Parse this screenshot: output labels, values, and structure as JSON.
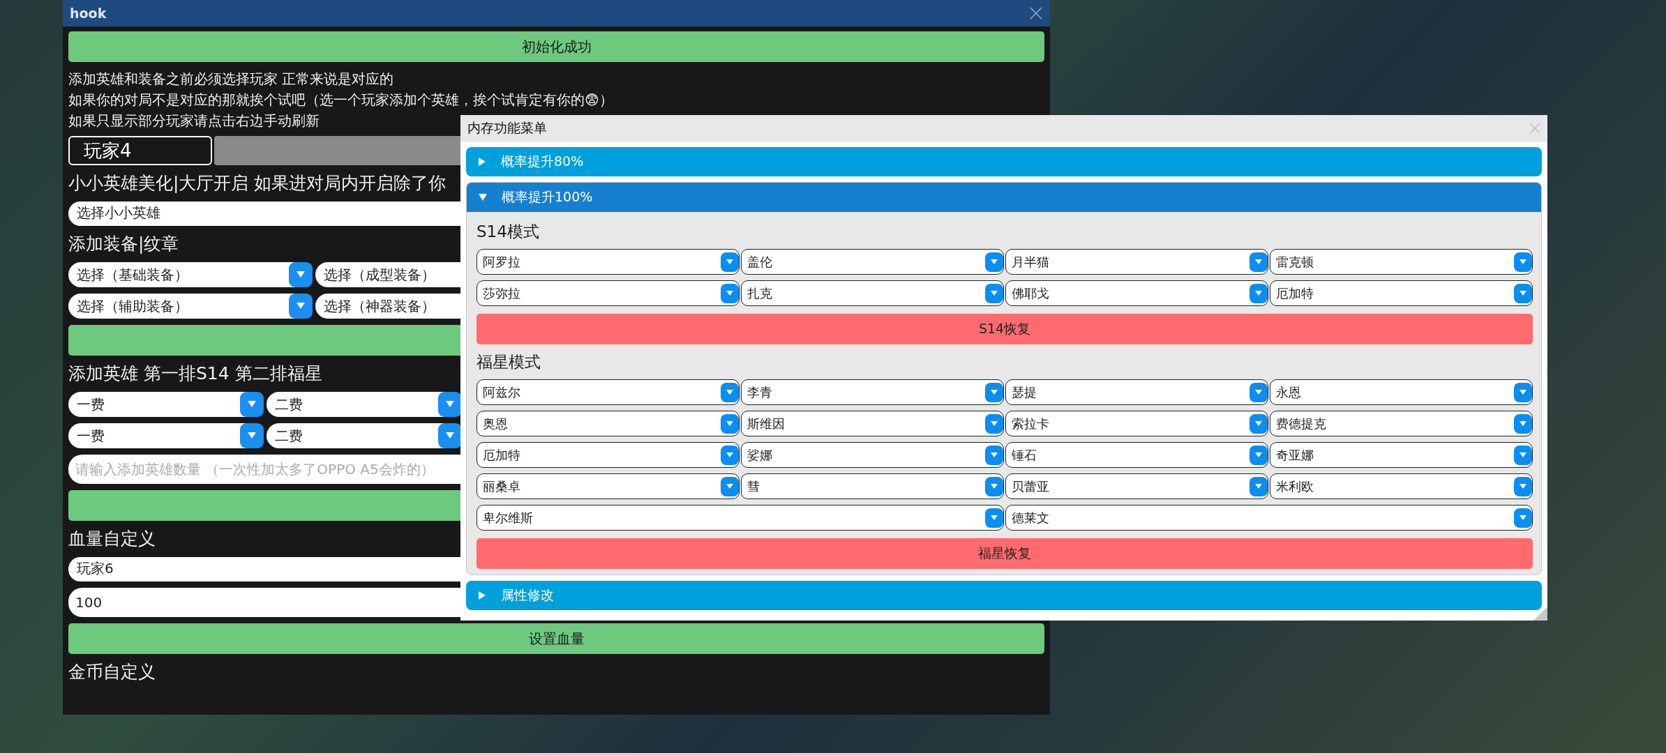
{
  "hook_window": {
    "title": "hook",
    "items": [
      {
        "kind": "button",
        "label": "初始化成功"
      },
      {
        "kind": "notes",
        "lines": [
          "添加英雄和装备之前必须选择玩家 正常来说是对应的",
          "如果你的对局不是对应的那就挨个试吧（选一个玩家添加个英雄，挨个试肯定有你的😨）",
          "如果只显示部分玩家请点击右边手动刷新"
        ]
      },
      {
        "kind": "tabs",
        "tabs": [
          {
            "label": "玩家4",
            "selected": true
          }
        ]
      },
      {
        "kind": "heading",
        "text": "小小英雄美化|大厅开启 如果进对局内开启除了你"
      },
      {
        "kind": "field",
        "value": "选择小小英雄"
      },
      {
        "kind": "heading",
        "text": "添加装备|纹章"
      },
      {
        "kind": "equip_selects",
        "options": [
          "选择（基础装备）",
          "选择（成型装备）"
        ]
      },
      {
        "kind": "equip_selects",
        "options": [
          "选择（辅助装备）",
          "选择（神器装备）"
        ]
      },
      {
        "kind": "button"
      },
      {
        "kind": "heading",
        "text": "添加英雄 第一排S14 第二排福星"
      },
      {
        "kind": "hero_selects",
        "options": [
          "一费",
          "二费"
        ]
      },
      {
        "kind": "hero_selects",
        "options": [
          "一费",
          "二费"
        ]
      },
      {
        "kind": "input",
        "placeholder": "请输入添加英雄数量 （一次性加太多了OPPO A5会炸的）"
      },
      {
        "kind": "button"
      },
      {
        "kind": "heading",
        "text": "血量自定义"
      },
      {
        "kind": "field",
        "value": "玩家6"
      },
      {
        "kind": "input",
        "value": "100"
      },
      {
        "kind": "button",
        "label": "设置血量"
      },
      {
        "kind": "heading",
        "text": "金币自定义"
      }
    ]
  },
  "memory_menu": {
    "title": "内存功能菜单",
    "sections": [
      {
        "title": "概率提升80%",
        "expanded": false
      },
      {
        "title": "概率提升100%",
        "expanded": true,
        "groups": [
          {
            "title": "S14模式",
            "selects": [
              {
                "value": "阿罗拉",
                "wide": false
              },
              {
                "value": "盖伦",
                "wide": false
              },
              {
                "value": "月半猫",
                "wide": false
              },
              {
                "value": "雷克顿",
                "wide": false
              },
              {
                "value": "莎弥拉",
                "wide": false
              },
              {
                "value": "扎克",
                "wide": false
              },
              {
                "value": "佛耶戈",
                "wide": false
              },
              {
                "value": "厄加特",
                "wide": false
              }
            ],
            "reset_button": "S14恢复"
          },
          {
            "title": "福星模式",
            "selects": [
              {
                "value": "阿兹尔",
                "wide": false
              },
              {
                "value": "李青",
                "wide": false
              },
              {
                "value": "瑟提",
                "wide": false
              },
              {
                "value": "永恩",
                "wide": false
              },
              {
                "value": "奥恩",
                "wide": false
              },
              {
                "value": "斯维因",
                "wide": false
              },
              {
                "value": "索拉卡",
                "wide": false
              },
              {
                "value": "费德提克",
                "wide": false
              },
              {
                "value": "厄加特",
                "wide": false
              },
              {
                "value": "娑娜",
                "wide": false
              },
              {
                "value": "锤石",
                "wide": false
              },
              {
                "value": "奇亚娜",
                "wide": false
              },
              {
                "value": "丽桑卓",
                "wide": false
              },
              {
                "value": "彗",
                "wide": false
              },
              {
                "value": "贝蕾亚",
                "wide": false
              },
              {
                "value": "米利欧",
                "wide": false
              },
              {
                "value": "卑尔维斯",
                "wide": true
              },
              {
                "value": "德莱文",
                "wide": true
              }
            ],
            "reset_button": "福星恢复"
          }
        ]
      },
      {
        "title": "属性修改",
        "expanded": false
      }
    ]
  }
}
